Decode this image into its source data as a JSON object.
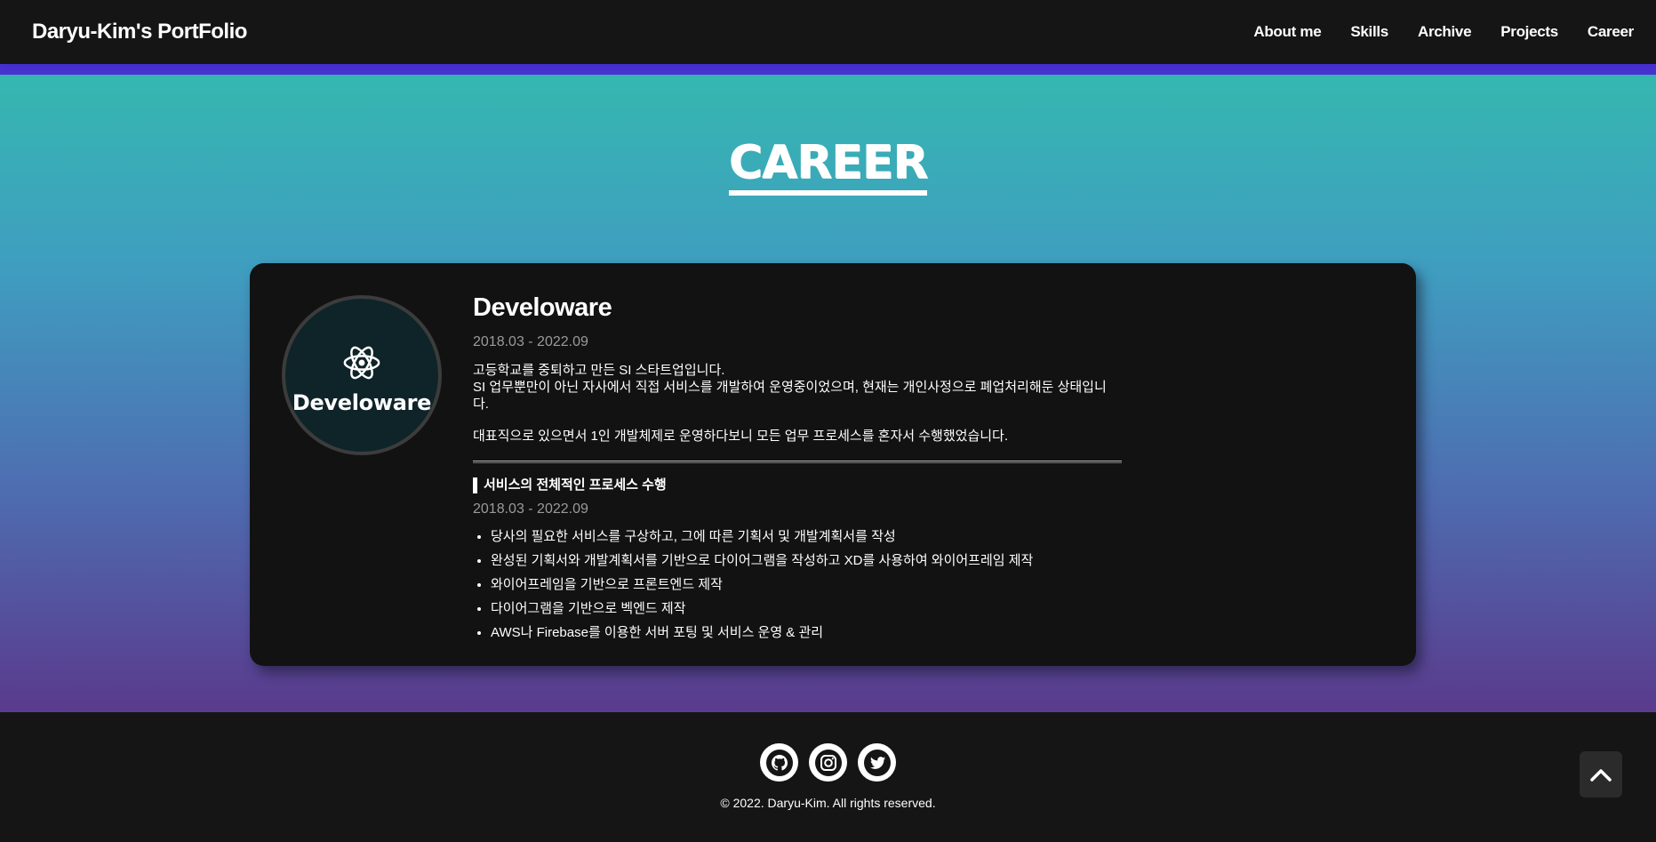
{
  "navbar": {
    "brand": "Daryu-Kim's PortFolio",
    "menu": [
      "About me",
      "Skills",
      "Archive",
      "Projects",
      "Career"
    ]
  },
  "section": {
    "heading": "CAREER"
  },
  "career": {
    "logo_text": "Develoware",
    "company": "Develoware",
    "period": "2018.03 - 2022.09",
    "description_line1": "고등학교를 중퇴하고 만든 SI 스타트업입니다.",
    "description_line2": "SI 업무뿐만이 아닌 자사에서 직접 서비스를 개발하여 운영중이었으며, 현재는 개인사정으로 폐업처리해둔 상태입니다.",
    "description_line3": "대표직으로 있으면서 1인 개발체제로 운영하다보니 모든 업무 프로세스를 혼자서 수행했었습니다.",
    "role_title": "서비스의 전체적인 프로세스 수행",
    "role_period": "2018.03 - 2022.09",
    "tasks": [
      "당사의 필요한 서비스를 구상하고, 그에 따른 기획서 및 개발계획서를 작성",
      "완성된 기획서와 개발계획서를 기반으로 다이어그램을 작성하고 XD를 사용하여 와이어프레임 제작",
      "와이어프레임을 기반으로 프론트엔드 제작",
      "다이어그램을 기반으로 벡엔드 제작",
      "AWS나 Firebase를 이용한 서버 포팅 및 서비스 운영 & 관리"
    ]
  },
  "footer": {
    "socials": [
      "github-icon",
      "instagram-icon",
      "twitter-icon"
    ],
    "copyright": "© 2022. Daryu-Kim. All rights reserved."
  },
  "colors": {
    "gradient_top": "#35b7b0",
    "gradient_bottom": "#5a3a8c",
    "card_bg": "#121212",
    "nav_bg": "#151515"
  }
}
